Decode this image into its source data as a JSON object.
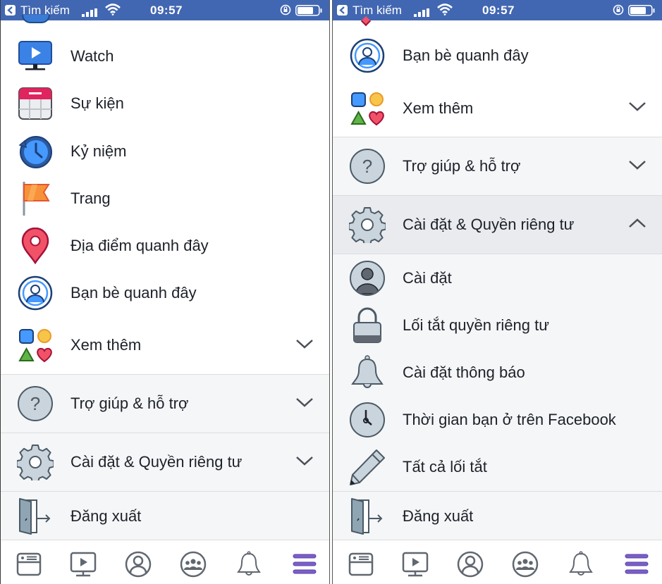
{
  "status_bar": {
    "back_label": "Tìm kiếm",
    "time": "09:57",
    "color": "#4267b2"
  },
  "left_panel": {
    "items": [
      {
        "label": "Watch",
        "icon": "watch-tv-icon"
      },
      {
        "label": "Sự kiện",
        "icon": "calendar-icon"
      },
      {
        "label": "Kỷ niệm",
        "icon": "memories-clock-icon"
      },
      {
        "label": "Trang",
        "icon": "flag-icon"
      },
      {
        "label": "Địa điểm quanh đây",
        "icon": "map-pin-icon"
      },
      {
        "label": "Bạn bè quanh đây",
        "icon": "nearby-friends-icon"
      },
      {
        "label": "Xem thêm",
        "icon": "shapes-icon",
        "expandable": true,
        "expanded": false
      }
    ],
    "sections": [
      {
        "label": "Trợ giúp & hỗ trợ",
        "icon": "help-icon",
        "expanded": false
      },
      {
        "label": "Cài đặt & Quyền riêng tư",
        "icon": "gear-icon",
        "expanded": false
      }
    ],
    "logout_label": "Đăng xuất"
  },
  "right_panel": {
    "items": [
      {
        "label": "Bạn bè quanh đây",
        "icon": "nearby-friends-icon"
      },
      {
        "label": "Xem thêm",
        "icon": "shapes-icon",
        "expandable": true,
        "expanded": false
      }
    ],
    "sections": [
      {
        "label": "Trợ giúp & hỗ trợ",
        "icon": "help-icon",
        "expanded": false
      },
      {
        "label": "Cài đặt & Quyền riêng tư",
        "icon": "gear-icon",
        "expanded": true
      }
    ],
    "sub_items": [
      {
        "label": "Cài đặt",
        "icon": "account-icon"
      },
      {
        "label": "Lối tắt quyền riêng tư",
        "icon": "lock-icon"
      },
      {
        "label": "Cài đặt thông báo",
        "icon": "bell-icon"
      },
      {
        "label": "Thời gian bạn ở trên Facebook",
        "icon": "clock-icon"
      },
      {
        "label": "Tất cả lối tắt",
        "icon": "pencil-icon"
      }
    ],
    "logout_label": "Đăng xuất"
  },
  "tab_bar": {
    "tabs": [
      {
        "name": "news-feed",
        "icon": "news-feed-icon",
        "active": false
      },
      {
        "name": "watch",
        "icon": "watch-tab-icon",
        "active": false
      },
      {
        "name": "profile",
        "icon": "profile-icon",
        "active": false
      },
      {
        "name": "groups",
        "icon": "groups-icon",
        "active": false
      },
      {
        "name": "notifications",
        "icon": "notifications-icon",
        "active": false
      },
      {
        "name": "menu",
        "icon": "menu-icon",
        "active": true
      }
    ],
    "active_color": "#7b5fc8",
    "inactive_color": "#606770"
  }
}
